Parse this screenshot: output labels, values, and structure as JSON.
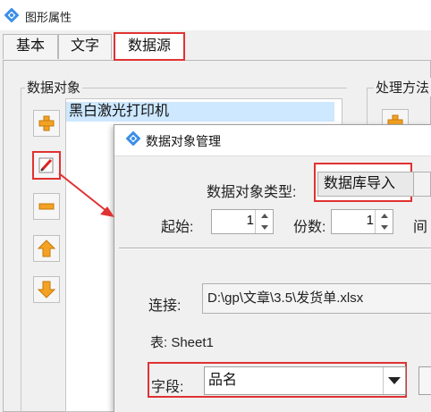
{
  "outer_window": {
    "title": "图形属性"
  },
  "tabs": [
    {
      "label": "基本"
    },
    {
      "label": "文字"
    },
    {
      "label": "数据源"
    }
  ],
  "data_object_group": {
    "label": "数据对象",
    "items": [
      "黑白激光打印机"
    ],
    "buttons": [
      "add-icon",
      "edit-icon",
      "remove-icon",
      "move-up-icon",
      "move-down-icon"
    ]
  },
  "process_group": {
    "label": "处理方法"
  },
  "dialog": {
    "title": "数据对象管理",
    "type_label": "数据对象类型:",
    "type_value": "数据库导入",
    "start_label": "起始:",
    "start_value": "1",
    "copies_label": "份数:",
    "copies_value": "1",
    "interval_label": "间",
    "connect_label": "连接:",
    "connect_value": "D:\\gp\\文章\\3.5\\发货单.xlsx",
    "table_text": "表: Sheet1",
    "field_label": "字段:",
    "field_value": "品名"
  },
  "colors": {
    "highlight": "#e03232",
    "selection": "#cde8ff",
    "icon_orange": "#f3a224"
  }
}
